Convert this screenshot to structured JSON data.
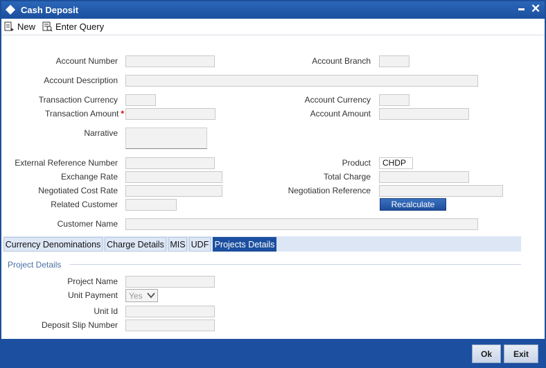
{
  "window": {
    "title": "Cash Deposit"
  },
  "toolbar": {
    "new_label": "New",
    "enter_query_label": "Enter Query"
  },
  "form": {
    "account_number_label": "Account Number",
    "account_branch_label": "Account Branch",
    "account_description_label": "Account Description",
    "transaction_currency_label": "Transaction Currency",
    "account_currency_label": "Account Currency",
    "transaction_amount_label": "Transaction Amount",
    "required_marker": "*",
    "account_amount_label": "Account Amount",
    "narrative_label": "Narrative",
    "external_reference_label": "External Reference Number",
    "product_label": "Product",
    "product_value": "CHDP",
    "exchange_rate_label": "Exchange Rate",
    "total_charge_label": "Total Charge",
    "negotiated_cost_rate_label": "Negotiated Cost Rate",
    "negotiation_reference_label": "Negotiation Reference",
    "related_customer_label": "Related Customer",
    "recalculate_label": "Recalculate",
    "customer_name_label": "Customer Name"
  },
  "tabs": [
    {
      "label": "Currency Denominations"
    },
    {
      "label": "Charge Details"
    },
    {
      "label": "MIS"
    },
    {
      "label": "UDF"
    },
    {
      "label": "Projects Details"
    }
  ],
  "project": {
    "section_title": "Project Details",
    "project_name_label": "Project Name",
    "unit_payment_label": "Unit Payment",
    "unit_payment_value": "Yes",
    "unit_id_label": "Unit Id",
    "deposit_slip_label": "Deposit Slip Number"
  },
  "footer": {
    "ok_label": "Ok",
    "exit_label": "Exit"
  },
  "colors": {
    "accent": "#1c4f9f",
    "tab_bg": "#dde7f6",
    "field_bg": "#f2f2f2",
    "required": "#dd0000"
  }
}
